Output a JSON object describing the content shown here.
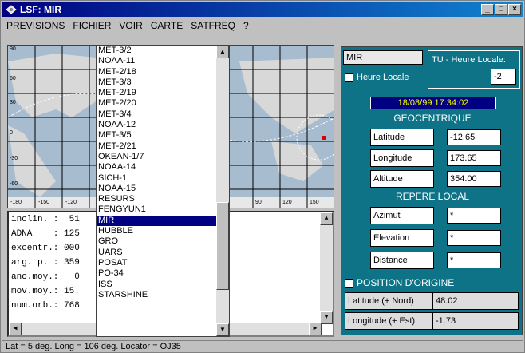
{
  "window": {
    "title": "LSF: MIR",
    "min_label": "_",
    "max_label": "□",
    "close_label": "×"
  },
  "menu": [
    "PREVISIONS",
    "FICHIER",
    "VOIR",
    "CARTE",
    "SATFREQ",
    "?"
  ],
  "map": {
    "lat_ticks": [
      "90",
      "60",
      "30",
      "0",
      "-30",
      "-60"
    ],
    "lon_ticks": [
      "-180",
      "-150",
      "-120",
      "90",
      "120",
      "150"
    ]
  },
  "orbital_params": [
    "inclin. :  51",
    "ADNA    : 125",
    "excentr.: 000",
    "arg. p. : 359",
    "ano.moy.:   0",
    "mov.moy.: 15.",
    "num.orb.: 768"
  ],
  "satellites": [
    "MET-3/2",
    "NOAA-11",
    "MET-2/18",
    "MET-3/3",
    "MET-2/19",
    "MET-2/20",
    "MET-3/4",
    "NOAA-12",
    "MET-3/5",
    "MET-2/21",
    "OKEAN-1/7",
    "NOAA-14",
    "SICH-1",
    "NOAA-15",
    "RESURS",
    "FENGYUN1",
    "MIR",
    "HUBBLE",
    "GRO",
    "UARS",
    "POSAT",
    "PO-34",
    "ISS",
    "STARSHINE"
  ],
  "selected_satellite": "MIR",
  "panel": {
    "sat_name": "MIR",
    "heure_locale_label": "Heure Locale",
    "tu_label": "TU - Heure Locale:",
    "tu_value": "-2",
    "datetime": "18/08/99 17:34:02",
    "geocentrique": "GEOCENTRIQUE",
    "latitude_label": "Latitude",
    "latitude_value": "-12.65",
    "longitude_label": "Longitude",
    "longitude_value": "173.65",
    "altitude_label": "Altitude",
    "altitude_value": "354.00",
    "repere_local": "REPERE LOCAL",
    "azimut_label": "Azimut",
    "azimut_value": "*",
    "elevation_label": "Elevation",
    "elevation_value": "*",
    "distance_label": "Distance",
    "distance_value": "*",
    "position_origine": "POSITION D'ORIGINE",
    "lat_nord_label": "Latitude (+ Nord)",
    "lat_nord_value": "48.02",
    "lon_est_label": "Longitude (+ Est)",
    "lon_est_value": "-1.73"
  },
  "status": "Lat = 5 deg.  Long = 106 deg.  Locator = OJ35",
  "colors": {
    "panel": "#0e7387",
    "titlebar": "#000080",
    "map_sea": "#9fb3c8"
  }
}
